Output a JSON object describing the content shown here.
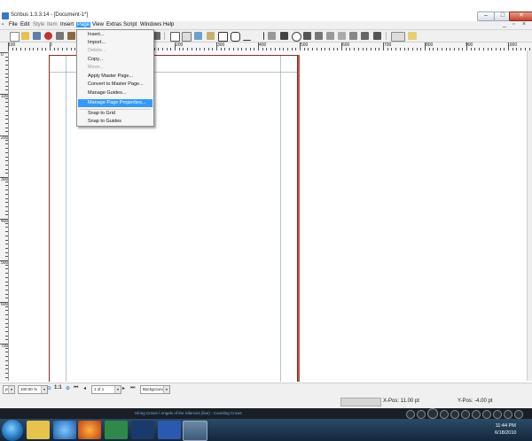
{
  "window": {
    "title": "Scribus 1.3.3.14 - [Document-1*]",
    "minimize_glyph": "–",
    "maximize_glyph": "□",
    "close_glyph": "✕"
  },
  "menubar": {
    "items": [
      "File",
      "Edit",
      "Style",
      "Item",
      "Insert",
      "Page",
      "View",
      "Extras",
      "Script",
      "Windows",
      "Help"
    ],
    "active": "Page",
    "mdi_min": "_",
    "mdi_restore": "▫",
    "mdi_close": "×"
  },
  "page_menu": {
    "items": [
      {
        "label": "Insert...",
        "disabled": false
      },
      {
        "label": "Import...",
        "disabled": false
      },
      {
        "label": "Delete...",
        "disabled": true
      },
      {
        "label": "Copy...",
        "disabled": false
      },
      {
        "label": "Move...",
        "disabled": true
      },
      {
        "label": "Apply Master Page...",
        "disabled": false
      },
      {
        "label": "Convert to Master Page...",
        "disabled": false
      },
      {
        "label": "Manage Guides...",
        "disabled": false
      },
      {
        "label": "Manage Page Properties...",
        "disabled": false
      },
      {
        "label": "Snap to Grid",
        "disabled": false
      },
      {
        "label": "Snap to Guides",
        "disabled": false
      }
    ],
    "highlighted": "Manage Page Properties..."
  },
  "rulers": {
    "h_labels": [
      "100",
      "0",
      "100",
      "200",
      "300",
      "400",
      "500",
      "600",
      "700",
      "800",
      "900",
      "1000",
      "1100"
    ],
    "v_labels": [
      "0",
      "100",
      "200",
      "300",
      "400",
      "500",
      "600",
      "700"
    ]
  },
  "bottom_bar": {
    "unit": "pt",
    "zoom": "100.00 %",
    "zoom_ratio": "1:1",
    "page_indicator": "1 of 1",
    "layer": "Background"
  },
  "status": {
    "x_pos": "X-Pos: 11.00 pt",
    "y_pos": "Y-Pos: -4.00 pt"
  },
  "media_bar": {
    "now_playing": "Hiring Crows / Angels of the Silences (live) - Counting Crows"
  },
  "taskbar": {
    "time": "11:44 PM",
    "date": "6/18/2010"
  },
  "colors": {
    "menu_highlight": "#3399ff",
    "page_border": "#8b2a22",
    "taskbar": "#1e3a56"
  }
}
